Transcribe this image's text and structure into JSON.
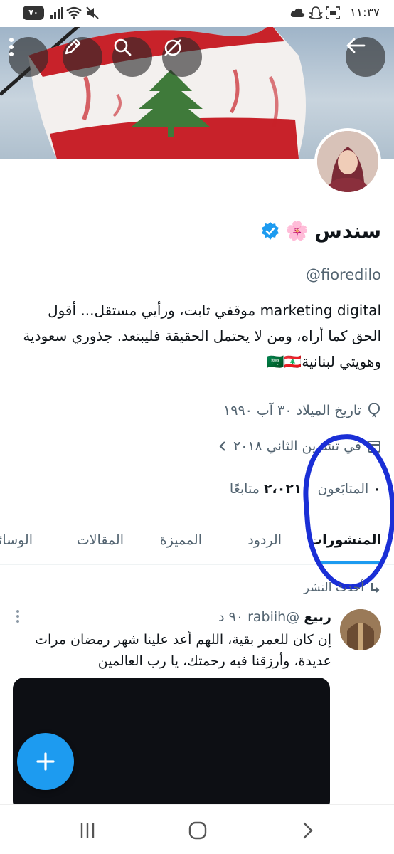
{
  "status_bar": {
    "time": "١١:٣٧",
    "battery": "٧٠",
    "icons": [
      "wifi-icon",
      "mute-icon",
      "signal-icon",
      "cloud-icon",
      "snapchat-icon",
      "screenshot-icon",
      "battery-icon"
    ]
  },
  "header": {
    "buttons": [
      "more-icon",
      "edit-icon",
      "search-icon",
      "grok-icon",
      "back-arrow-icon"
    ]
  },
  "profile": {
    "name": "سندس",
    "name_emoji": "🌸",
    "handle": "@fioredilo",
    "bio_line1": "marketing digital  موقفي ثابت، ورأيي مستقل... أقول",
    "bio_line2": "الحق كما أراه، ومن لا يحتمل الحقيقة فليبتعد.  جذوري سعودية",
    "bio_line3": "وهويتي لبنانية🇸🇦🇱🇧",
    "birthday": "تاريخ الميلاد ٣٠ آب ١٩٩٠",
    "joined": "في تشرين الثاني ٢٠١٨",
    "followers_count": "٠",
    "followers_label": "المتابَعون",
    "following_count": "٢،٠٢١",
    "following_label": "متابعًا"
  },
  "tabs": [
    {
      "label": "المنشورات",
      "active": true
    },
    {
      "label": "الردود",
      "active": false
    },
    {
      "label": "المميزة",
      "active": false
    },
    {
      "label": "المقالات",
      "active": false
    },
    {
      "label": "الوسائط",
      "active": false
    }
  ],
  "feed": {
    "section_label": "أحدثَ النشر",
    "post": {
      "name": "ربيع",
      "handle": "@rabiih",
      "time": "٩٠ د",
      "text": "إن كان للعمر بقية، اللهم أعد علينا شهر رمضان مرات عديدة، وأرزقنا فيه رحمتك، يا رب العالمين"
    }
  },
  "colors": {
    "accent": "#1d9bf0",
    "annotation": "#1a2fd6",
    "text_primary": "#0f1419",
    "text_secondary": "#536471"
  }
}
